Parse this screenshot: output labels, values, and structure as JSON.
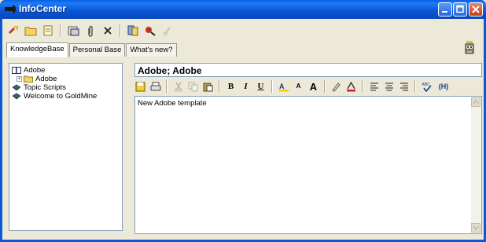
{
  "window": {
    "title": "InfoCenter",
    "colors": {
      "title_bar": "#0a58d8",
      "face": "#ece9d8"
    }
  },
  "toolbar": {
    "icons": [
      "new-icon",
      "folder-icon",
      "page-icon",
      "properties-icon",
      "attach-icon",
      "delete-icon",
      "book-icon",
      "search-icon",
      "link-icon"
    ]
  },
  "tabs": [
    {
      "label": "KnowledgeBase",
      "active": true
    },
    {
      "label": "Personal Base",
      "active": false
    },
    {
      "label": "What's new?",
      "active": false
    }
  ],
  "tree": {
    "items": [
      {
        "label": "Adobe",
        "icon": "book-icon",
        "level": 0
      },
      {
        "label": "Adobe",
        "icon": "folder-icon",
        "level": 1,
        "expandable": true,
        "selected": true
      },
      {
        "label": "Topic Scripts",
        "icon": "book-icon",
        "level": 0
      },
      {
        "label": "Welcome to GoldMine",
        "icon": "book-icon",
        "level": 0
      }
    ]
  },
  "topic": {
    "title": "Adobe; Adobe",
    "body": "New Adobe template"
  },
  "format_toolbar": {
    "bold": "B",
    "italic": "I",
    "underline": "U",
    "font_size_small": "A",
    "font_size_large": "A",
    "spell_icon": "ABC",
    "misc": "(H)"
  }
}
